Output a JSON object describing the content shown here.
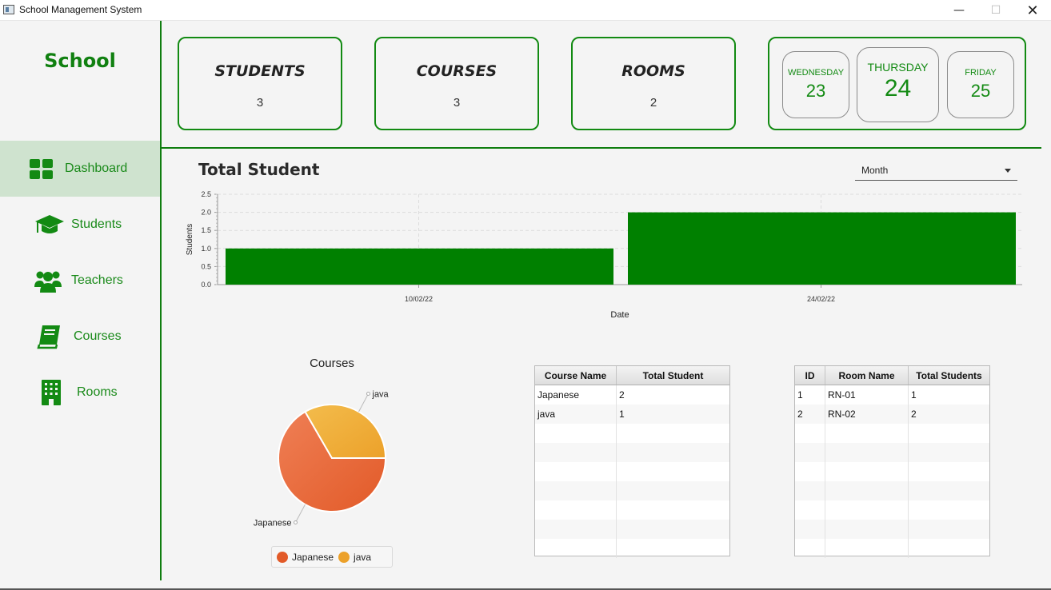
{
  "window": {
    "title": "School Management System",
    "min": "—",
    "max": "☐",
    "close": "✕"
  },
  "sidebar": {
    "brand": "School",
    "items": [
      {
        "label": "Dashboard",
        "icon": "dashboard-grid-icon",
        "active": true
      },
      {
        "label": "Students",
        "icon": "graduation-cap-icon",
        "active": false
      },
      {
        "label": "Teachers",
        "icon": "people-group-icon",
        "active": false
      },
      {
        "label": "Courses",
        "icon": "book-icon",
        "active": false
      },
      {
        "label": "Rooms",
        "icon": "building-icon",
        "active": false
      }
    ]
  },
  "stats": {
    "students": {
      "title": "STUDENTS",
      "value": "3"
    },
    "courses": {
      "title": "COURSES",
      "value": "3"
    },
    "rooms": {
      "title": "ROOMS",
      "value": "2"
    }
  },
  "dates": {
    "prev": {
      "name": "WEDNESDAY",
      "day": "23"
    },
    "current": {
      "name": "THURSDAY",
      "day": "24"
    },
    "next": {
      "name": "FRIDAY",
      "day": "25"
    }
  },
  "students_chart": {
    "title": "Total Student",
    "period": "Month"
  },
  "chart_data": [
    {
      "type": "bar",
      "categories": [
        "10/02/22",
        "24/02/22"
      ],
      "values": [
        1.0,
        2.0
      ],
      "xlabel": "Date",
      "ylabel": "Students",
      "ylim": [
        0,
        2.5
      ],
      "yticks": [
        "0.0",
        "0.5",
        "1.0",
        "1.5",
        "2.0",
        "2.5"
      ],
      "grid": true,
      "color": "#008000"
    },
    {
      "type": "pie",
      "title": "Courses",
      "labels": [
        "Japanese",
        "java"
      ],
      "values": [
        2,
        1
      ],
      "colors": [
        "#e25a28",
        "#eca12a"
      ],
      "legend": "bottom"
    }
  ],
  "course_table": {
    "columns": [
      "Course Name",
      "Total Student"
    ],
    "rows": [
      [
        "Japanese",
        "2"
      ],
      [
        "java",
        "1"
      ]
    ]
  },
  "room_table": {
    "columns": [
      "ID",
      "Room Name",
      "Total Students"
    ],
    "rows": [
      [
        "1",
        "RN-01",
        "1"
      ],
      [
        "2",
        "RN-02",
        "2"
      ]
    ]
  }
}
